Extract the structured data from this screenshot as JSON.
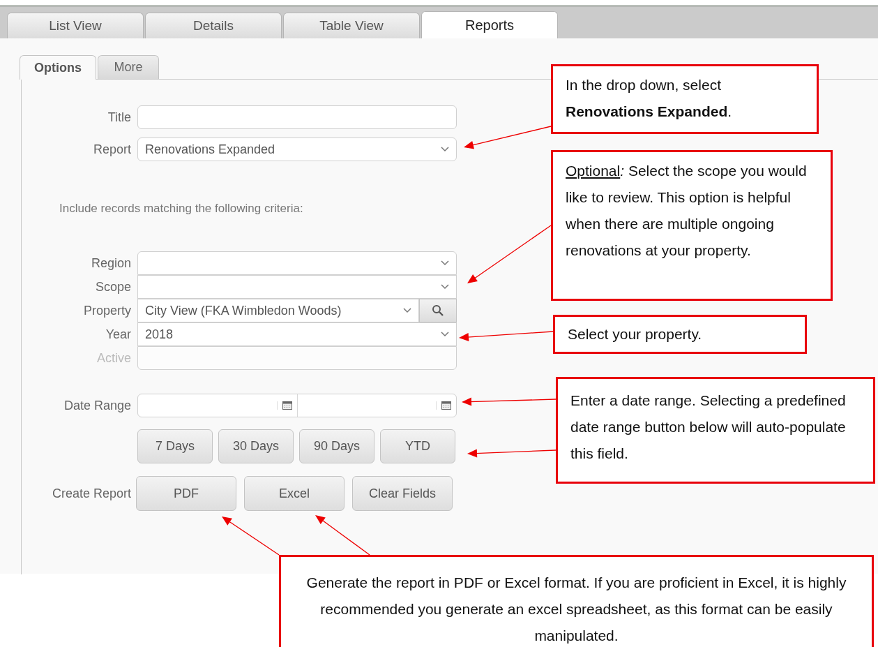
{
  "tabs": [
    {
      "label": "List View",
      "selected": false
    },
    {
      "label": "Details",
      "selected": false
    },
    {
      "label": "Table View",
      "selected": false
    },
    {
      "label": "Reports",
      "selected": true
    }
  ],
  "subtabs": [
    {
      "label": "Options",
      "selected": true
    },
    {
      "label": "More",
      "selected": false
    }
  ],
  "fields": [
    {
      "kind": "text",
      "label": "Title"
    },
    {
      "kind": "select",
      "label": "Report",
      "value": "Renovations Expanded"
    }
  ],
  "criteria_note": "Include records matching the following criteria:",
  "criteria": [
    {
      "kind": "select",
      "label": "Region",
      "disabled": false
    },
    {
      "kind": "select",
      "label": "Scope",
      "disabled": false
    },
    {
      "kind": "select_search",
      "label": "Property",
      "value": "City View (FKA Wimbledon Woods)",
      "disabled": false
    },
    {
      "kind": "select",
      "label": "Year",
      "value": "2018",
      "disabled": false
    },
    {
      "kind": "text",
      "label": "Active",
      "disabled": true
    }
  ],
  "date_range": {
    "label": "Date Range"
  },
  "quick_ranges": [
    "7 Days",
    "30 Days",
    "90 Days",
    "YTD"
  ],
  "create_report": {
    "label": "Create Report",
    "buttons": [
      "PDF",
      "Excel",
      "Clear Fields"
    ]
  },
  "callouts": [
    {
      "text": "In the drop down, select **Renovations Expanded**."
    },
    {
      "lead": "Optional",
      "text": "*:*  Select the scope you would like to review. This option is helpful when there are multiple ongoing renovations at your property."
    },
    {
      "text": "Select your property."
    },
    {
      "text": "Enter a date range. Selecting a predefined date range button below will auto-populate this field."
    },
    {
      "text": "Generate the report in PDF or Excel format. If you are proficient in Excel, it is highly recommended you generate an excel spreadsheet, as this format can be easily manipulated."
    }
  ]
}
